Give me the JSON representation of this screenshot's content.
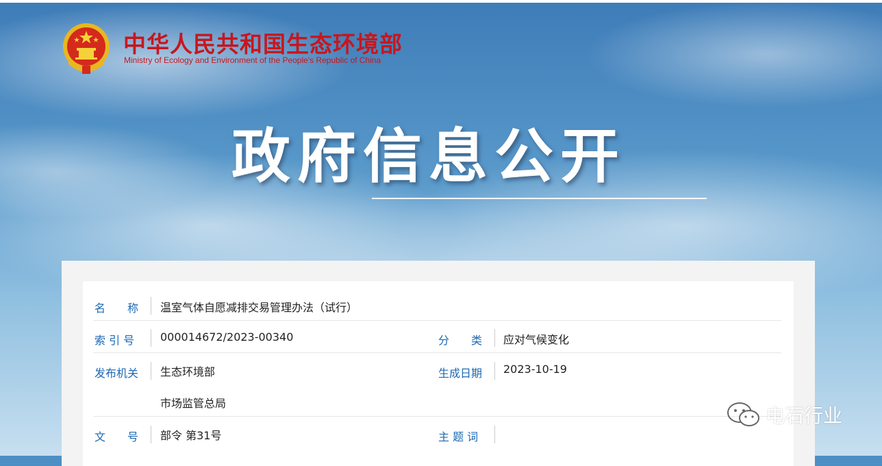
{
  "header": {
    "ministry_name_cn": "中华人民共和国生态环境部",
    "ministry_name_en": "Ministry of Ecology and Environment of the People's Republic of China",
    "emblem_icon": "national-emblem-icon"
  },
  "banner": {
    "title": "政府信息公开"
  },
  "info_table": {
    "name_label": "名　　称",
    "name_value": "温室气体自愿减排交易管理办法（试行）",
    "index_label": "索 引 号",
    "index_value": "000014672/2023-00340",
    "category_label": "分　　类",
    "category_value": "应对气候变化",
    "publisher_label": "发布机关",
    "publisher_value_1": "生态环境部",
    "publisher_value_2": "市场监管总局",
    "date_label": "生成日期",
    "date_value": "2023-10-19",
    "doc_no_label": "文　　号",
    "doc_no_value": "部令 第31号",
    "subject_label": "主 题 词",
    "subject_value": ""
  },
  "watermark": {
    "text": "电石行业",
    "icon": "wechat-icon"
  },
  "colors": {
    "brand_red": "#c8161d",
    "label_blue": "#1c68b3"
  }
}
